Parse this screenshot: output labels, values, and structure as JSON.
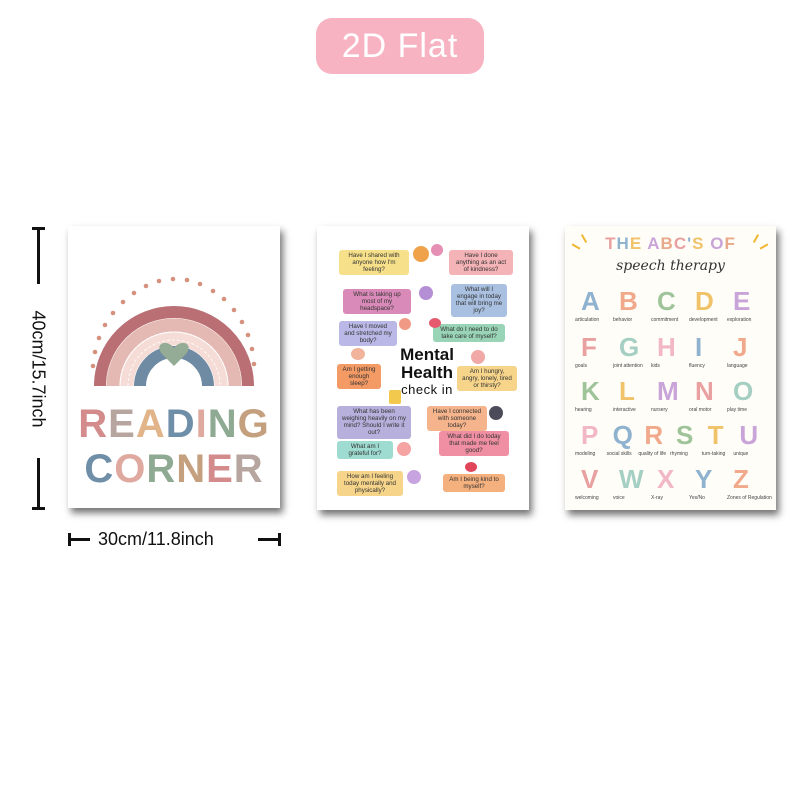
{
  "badge": "2D Flat",
  "dimensions": {
    "height_label": "40cm/15.7inch",
    "width_label": "30cm/11.8inch"
  },
  "poster_reading": {
    "line1": [
      "R",
      "E",
      "A",
      "D",
      "I",
      "N",
      "G"
    ],
    "line2": [
      "C",
      "O",
      "R",
      "N",
      "E",
      "R"
    ],
    "colors": [
      "#d48b8b",
      "#b7a6a0",
      "#e2b48a",
      "#6f8fa8",
      "#e0a9a0",
      "#8faa92",
      "#c4a07f"
    ]
  },
  "poster_mental": {
    "title_line1": "Mental",
    "title_line2": "Health",
    "title_line3": "check in",
    "bubbles": [
      "Have I shared with anyone how I'm feeling?",
      "Have I done anything as an act of kindness?",
      "What is taking up most of my headspace?",
      "What will I engage in today that will bring me joy?",
      "Have I moved and stretched my body?",
      "What do I need to do take care of myself?",
      "Am I getting enough sleep?",
      "Am I hungry, angry, lonely, tired or thirsty?",
      "What has been weighing heavily on my mind? Should I write it out?",
      "Have I connected with someone today?",
      "What am I grateful for?",
      "What did I do today that made me feel good?",
      "How am I feeling today mentally and physically?",
      "Am I being kind to myself?"
    ]
  },
  "poster_abc": {
    "title_line1": "THE ABC'S OF",
    "title_line2": "speech therapy",
    "letters": [
      "A",
      "B",
      "C",
      "D",
      "E",
      "F",
      "G",
      "H",
      "I",
      "J",
      "K",
      "L",
      "M",
      "N",
      "O",
      "P",
      "Q",
      "R",
      "S",
      "T",
      "U",
      "V",
      "W",
      "X",
      "Y",
      "Z"
    ],
    "captions": [
      "articulation",
      "behavior",
      "commitment",
      "development",
      "exploration",
      "goals",
      "joint attention",
      "kids",
      "fluency",
      "language",
      "hearing",
      "interactive",
      "nursery",
      "oral motor",
      "play time",
      "modeling",
      "social skills",
      "quality of life",
      "rhyming",
      "turn-taking",
      "unique",
      "welcoming",
      "voice",
      "X-ray",
      "Yes/No",
      "Zones of Regulation"
    ]
  }
}
